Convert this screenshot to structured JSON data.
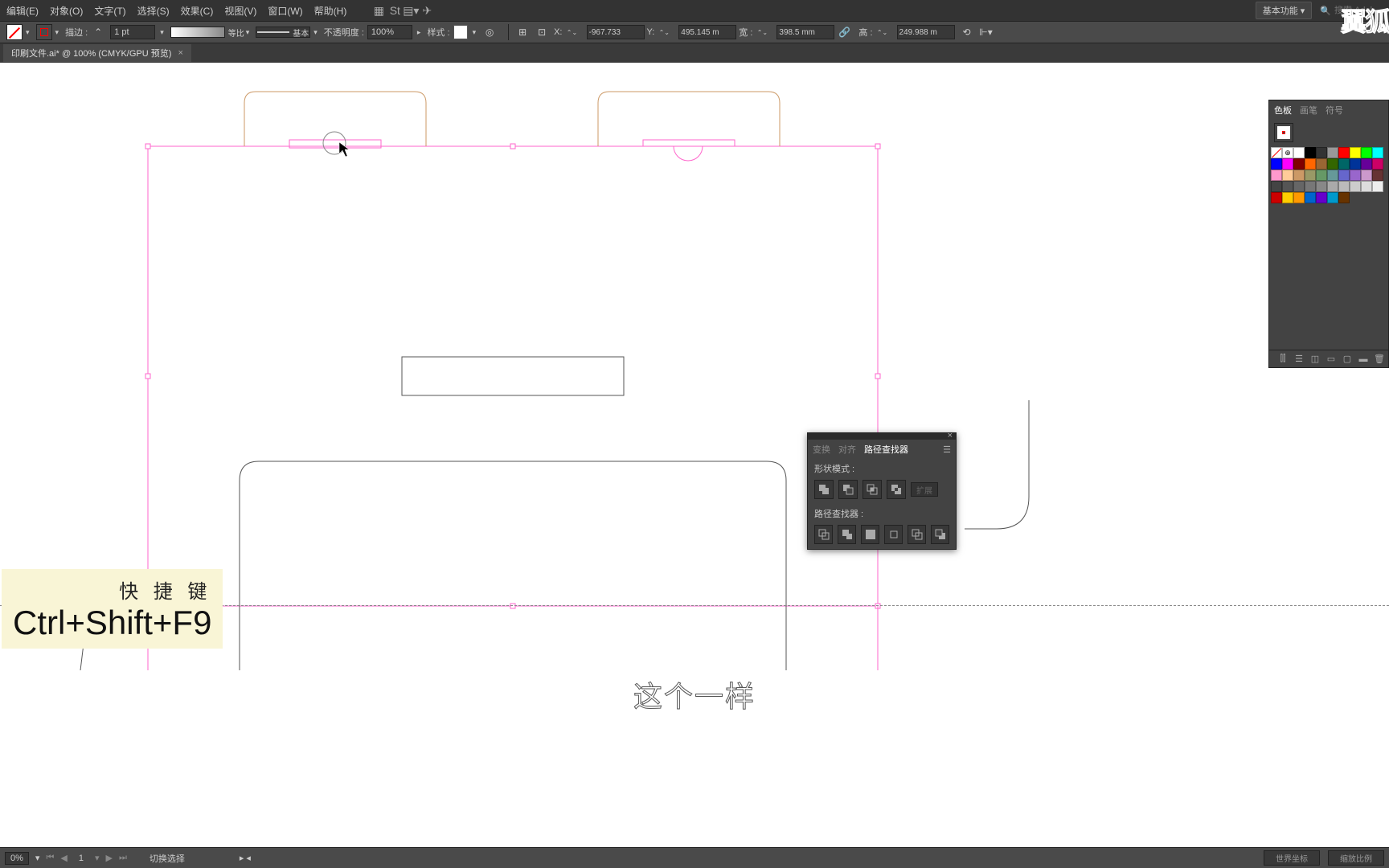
{
  "menu": {
    "edit": "编辑(E)",
    "object": "对象(O)",
    "text": "文字(T)",
    "select": "选择(S)",
    "effect": "效果(C)",
    "view": "视图(V)",
    "window": "窗口(W)",
    "help": "帮助(H)",
    "workspace": "基本功能",
    "search_placeholder": "搜索 Adob"
  },
  "control": {
    "stroke_label": "描边 :",
    "stroke_weight": "1 pt",
    "stroke_uniform": "等比",
    "stroke_basic": "基本",
    "opacity_label": "不透明度 :",
    "opacity_value": "100%",
    "style_label": "样式 :",
    "x_label": "X:",
    "x_value": "-967.733",
    "y_label": "Y:",
    "y_value": "495.145 m",
    "w_label": "宽 :",
    "w_value": "398.5 mm",
    "h_label": "高 :",
    "h_value": "249.988 m"
  },
  "doc_tab": {
    "title": "印刷文件.ai* @ 100% (CMYK/GPU 预览)"
  },
  "shortcut": {
    "label": "快 捷 键",
    "keys": "Ctrl+Shift+F9"
  },
  "subtitle": "这个一样",
  "swatches_panel": {
    "tab_swatches": "色板",
    "tab_brushes": "画笔",
    "tab_symbols": "符号"
  },
  "pathfinder_panel": {
    "tab_transform": "变换",
    "tab_align": "对齐",
    "tab_pathfinder": "路径查找器",
    "shape_modes": "形状模式 :",
    "expand": "扩展",
    "pathfinders": "路径查找器 :"
  },
  "status": {
    "zoom": "0%",
    "tool_hint": "切换选择",
    "right1": "世界坐标",
    "right2": "缩放比例"
  },
  "logo": "翼狐",
  "swatch_colors": [
    "#ffffff",
    "#000000",
    "#333333",
    "#999999",
    "#ff0000",
    "#ffff00",
    "#00ff00",
    "#00ffff",
    "#0000ff",
    "#ff00ff",
    "#800000",
    "#ff6600",
    "#996633",
    "#336600",
    "#006666",
    "#003399",
    "#660099",
    "#cc0066",
    "#ff99cc",
    "#ffcc99",
    "#cc9966",
    "#999966",
    "#669966",
    "#669999",
    "#6666cc",
    "#9966cc",
    "#cc99cc",
    "#663333",
    "#444444",
    "#555555",
    "#666666",
    "#777777",
    "#888888",
    "#aaaaaa",
    "#bbbbbb",
    "#cccccc",
    "#dddddd",
    "#eeeeee",
    "#cc0000",
    "#ffcc00",
    "#ff9900",
    "#0066cc",
    "#6600cc",
    "#0099cc",
    "#663300"
  ]
}
